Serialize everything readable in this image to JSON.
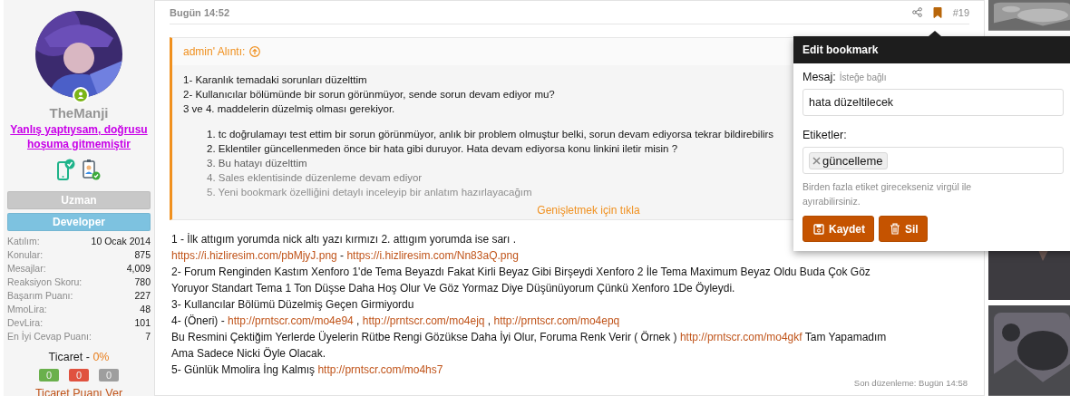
{
  "user": {
    "avatar": {
      "kind": "picture",
      "online": true
    },
    "name": "TheManji",
    "custom_title": "Yanlış yaptıysam, doğrusu hoşuma gitmemiştir",
    "banners": [
      {
        "label": "Uzman",
        "color": "#c8c8c8"
      },
      {
        "label": "Developer",
        "color": "#7dc2e0"
      }
    ],
    "stats": [
      {
        "label": "Katılım:",
        "value": "10 Ocak 2014"
      },
      {
        "label": "Konular:",
        "value": "875"
      },
      {
        "label": "Mesajlar:",
        "value": "4,009"
      },
      {
        "label": "Reaksiyon Skoru:",
        "value": "780"
      },
      {
        "label": "Başarım Puanı:",
        "value": "227"
      },
      {
        "label": "MmoLira:",
        "value": "48"
      },
      {
        "label": "DevLira:",
        "value": "101"
      },
      {
        "label": "En İyi Cevap Puanı:",
        "value": "7"
      }
    ],
    "trade": {
      "label": "Ticaret - ",
      "percent": "0%",
      "counts": [
        {
          "value": "0",
          "color": "#6ab04c"
        },
        {
          "value": "0",
          "color": "#e0523f"
        },
        {
          "value": "0",
          "color": "#9e9e9e"
        }
      ],
      "action": "Ticaret Puanı Ver"
    }
  },
  "post": {
    "date": "Bugün 14:52",
    "bookmarked": true,
    "number": "#19",
    "quote": {
      "title": "admin' Alıntı:",
      "lines": [
        "1- Karanlık temadaki sorunları düzelttim",
        "2- Kullanıcılar bölümünde bir sorun görünmüyor, sende sorun devam ediyor mu?",
        "3 ve 4. maddelerin düzelmiş olması gerekiyor."
      ],
      "items": [
        {
          "number": "1.",
          "text": "tc doğrulamayı test ettim bir sorun görünmüyor, anlık bir problem olmuştur belki, sorun devam ediyorsa tekrar bildirebilirs"
        },
        {
          "number": "2.",
          "text": "Eklentiler güncellenmeden önce bir hata gibi duruyor. Hata devam ediyorsa konu linkini iletir misin ?"
        },
        {
          "number": "3.",
          "text": "Bu hatayı düzelttim"
        },
        {
          "number": "4.",
          "text": "Sales eklentisinde düzenleme devam ediyor"
        },
        {
          "number": "5.",
          "text": "Yeni bookmark özelliğini detaylı inceleyip bir anlatım hazırlayacağım"
        }
      ],
      "expand": "Genişletmek için tıkla"
    },
    "body": [
      [
        {
          "kind": "text",
          "text": "1 - İlk attıgım yorumda nick altı yazı kırmızı 2. attıgım yorumda ise sarı ."
        }
      ],
      [
        {
          "kind": "link",
          "text": "https://i.hizliresim.com/pbMjyJ.png"
        },
        {
          "kind": "text",
          "text": " - "
        },
        {
          "kind": "link",
          "text": "https://i.hizliresim.com/Nn83aQ.png"
        }
      ],
      [
        {
          "kind": "text",
          "text": "2- Forum Renginden Kastım Xenforo 1'de Tema Beyazdı Fakat Kirli Beyaz Gibi Birşeydi Xenforo 2 İle Tema Maximum Beyaz Oldu Buda Çok Göz"
        }
      ],
      [
        {
          "kind": "text",
          "text": "Yoruyor Standart Tema 1 Ton Düşse Daha Hoş Olur Ve Göz Yormaz Diye Düşünüyorum Çünkü Xenforo 1De Öyleydi."
        }
      ],
      [
        {
          "kind": "text",
          "text": "3- Kullancılar Bölümü Düzelmiş Geçen Girmiyordu"
        }
      ],
      [
        {
          "kind": "text",
          "text": "4- (Öneri) - "
        },
        {
          "kind": "link",
          "text": "http://prntscr.com/mo4e94"
        },
        {
          "kind": "text",
          "text": " , "
        },
        {
          "kind": "link",
          "text": "http://prntscr.com/mo4ejq"
        },
        {
          "kind": "text",
          "text": " , "
        },
        {
          "kind": "link",
          "text": "http://prntscr.com/mo4epq"
        }
      ],
      [
        {
          "kind": "text",
          "text": "Bu Resmini Çektiğim Yerlerde Üyelerin Rütbe Rengi Gözükse Daha İyi Olur, Foruma Renk Verir ( Örnek ) "
        },
        {
          "kind": "link",
          "text": "http://prntscr.com/mo4gkf"
        },
        {
          "kind": "text",
          "text": " Tam Yapamadım"
        }
      ],
      [
        {
          "kind": "text",
          "text": "Ama Sadece Nicki Öyle Olacak."
        }
      ],
      [
        {
          "kind": "text",
          "text": "5- Günlük Mmolira İng Kalmış "
        },
        {
          "kind": "link",
          "text": "http://prntscr.com/mo4hs7"
        }
      ]
    ],
    "last_edit": "Son düzenleme: Bugün 14:58"
  },
  "bookmark_popup": {
    "title": "Edit bookmark",
    "message_label": "Mesaj:",
    "message_hint": "İsteğe bağlı",
    "message_value": "hata düzeltilecek",
    "tags_label": "Etiketler:",
    "tags": [
      "güncelleme"
    ],
    "tags_help": "Birden fazla etiket girecekseniz virgül ile ayırabilirsiniz.",
    "buttons": [
      {
        "kind": "save",
        "label": "Kaydet"
      },
      {
        "kind": "delete",
        "label": "Sil"
      }
    ]
  },
  "ads": [
    {
      "kind": "picture"
    },
    {
      "kind": "picture"
    },
    {
      "kind": "picture"
    }
  ]
}
